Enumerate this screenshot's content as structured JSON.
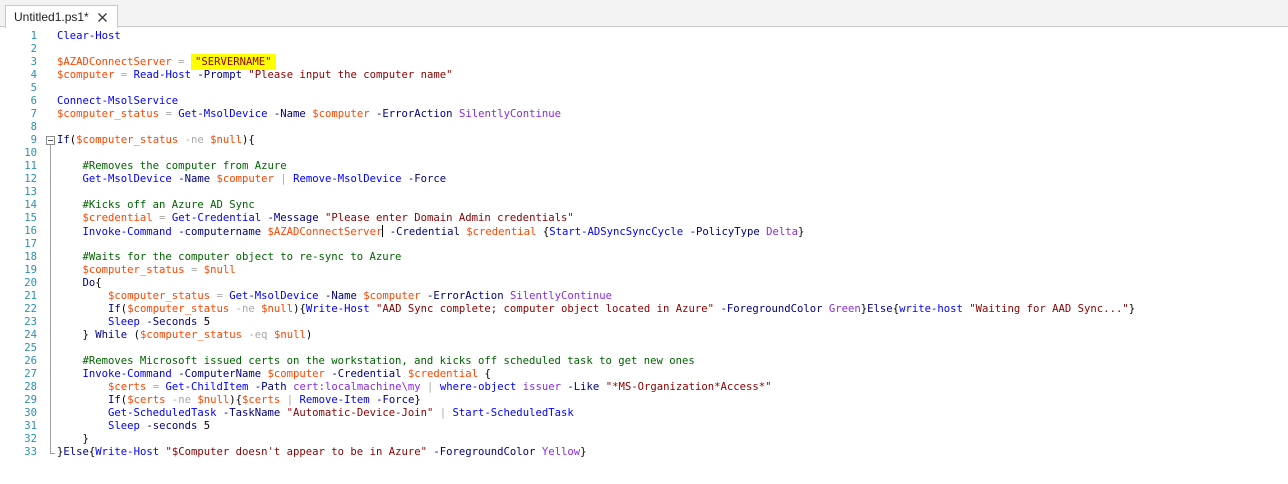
{
  "tab": {
    "title": "Untitled1.ps1*",
    "close_icon": "close-icon"
  },
  "colors": {
    "line_number": "#2b91af",
    "command": "#0000ff",
    "variable": "#ff4500",
    "string": "#8b0000",
    "parameter": "#000080",
    "operator": "#a9a9a9",
    "keyword": "#00008b",
    "comment": "#006400",
    "argument": "#8a2be2",
    "highlight": "#ffff00"
  },
  "lines": [
    {
      "n": "1",
      "indent": 0,
      "tokens": [
        [
          "cmd",
          "Clear-Host"
        ]
      ]
    },
    {
      "n": "2",
      "indent": 0,
      "tokens": []
    },
    {
      "n": "3",
      "indent": 0,
      "tokens": [
        [
          "var",
          "$AZADConnectServer"
        ],
        [
          "tx",
          " "
        ],
        [
          "op",
          "="
        ],
        [
          "tx",
          " "
        ],
        [
          "str-hl",
          "\"SERVERNAME\""
        ]
      ]
    },
    {
      "n": "4",
      "indent": 0,
      "tokens": [
        [
          "var",
          "$computer"
        ],
        [
          "tx",
          " "
        ],
        [
          "op",
          "="
        ],
        [
          "tx",
          " "
        ],
        [
          "cmd",
          "Read-Host"
        ],
        [
          "tx",
          " "
        ],
        [
          "par",
          "-Prompt"
        ],
        [
          "tx",
          " "
        ],
        [
          "str",
          "\"Please input the computer name\""
        ]
      ]
    },
    {
      "n": "5",
      "indent": 0,
      "tokens": []
    },
    {
      "n": "6",
      "indent": 0,
      "tokens": [
        [
          "cmd",
          "Connect-MsolService"
        ]
      ]
    },
    {
      "n": "7",
      "indent": 0,
      "tokens": [
        [
          "var",
          "$computer_status"
        ],
        [
          "tx",
          " "
        ],
        [
          "op",
          "="
        ],
        [
          "tx",
          " "
        ],
        [
          "cmd",
          "Get-MsolDevice"
        ],
        [
          "tx",
          " "
        ],
        [
          "par",
          "-Name"
        ],
        [
          "tx",
          " "
        ],
        [
          "var",
          "$computer"
        ],
        [
          "tx",
          " "
        ],
        [
          "par",
          "-ErrorAction"
        ],
        [
          "tx",
          " "
        ],
        [
          "arg",
          "SilentlyContinue"
        ]
      ]
    },
    {
      "n": "8",
      "indent": 0,
      "tokens": []
    },
    {
      "n": "9",
      "indent": 0,
      "fold": "start",
      "tokens": [
        [
          "kw",
          "If"
        ],
        [
          "grp",
          "("
        ],
        [
          "var",
          "$computer_status"
        ],
        [
          "tx",
          " "
        ],
        [
          "op",
          "-ne"
        ],
        [
          "tx",
          " "
        ],
        [
          "var",
          "$null"
        ],
        [
          "grp",
          "){"
        ]
      ]
    },
    {
      "n": "10",
      "indent": 0,
      "tokens": []
    },
    {
      "n": "11",
      "indent": 4,
      "tokens": [
        [
          "cmt",
          "#Removes the computer from Azure"
        ]
      ]
    },
    {
      "n": "12",
      "indent": 4,
      "tokens": [
        [
          "cmd",
          "Get-MsolDevice"
        ],
        [
          "tx",
          " "
        ],
        [
          "par",
          "-Name"
        ],
        [
          "tx",
          " "
        ],
        [
          "var",
          "$computer"
        ],
        [
          "tx",
          " "
        ],
        [
          "op",
          "|"
        ],
        [
          "tx",
          " "
        ],
        [
          "cmd",
          "Remove-MsolDevice"
        ],
        [
          "tx",
          " "
        ],
        [
          "par",
          "-Force"
        ]
      ]
    },
    {
      "n": "13",
      "indent": 0,
      "tokens": []
    },
    {
      "n": "14",
      "indent": 4,
      "tokens": [
        [
          "cmt",
          "#Kicks off an Azure AD Sync"
        ]
      ]
    },
    {
      "n": "15",
      "indent": 4,
      "tokens": [
        [
          "var",
          "$credential"
        ],
        [
          "tx",
          " "
        ],
        [
          "op",
          "="
        ],
        [
          "tx",
          " "
        ],
        [
          "cmd",
          "Get-Credential"
        ],
        [
          "tx",
          " "
        ],
        [
          "par",
          "-Message"
        ],
        [
          "tx",
          " "
        ],
        [
          "str",
          "\"Please enter Domain Admin credentials\""
        ]
      ]
    },
    {
      "n": "16",
      "indent": 4,
      "tokens": [
        [
          "cmd",
          "Invoke-Command"
        ],
        [
          "tx",
          " "
        ],
        [
          "par",
          "-computername"
        ],
        [
          "tx",
          " "
        ],
        [
          "var",
          "$AZADConnectServer"
        ],
        [
          "caret",
          ""
        ],
        [
          "tx",
          " "
        ],
        [
          "par",
          "-Credential"
        ],
        [
          "tx",
          " "
        ],
        [
          "var",
          "$credential"
        ],
        [
          "tx",
          " "
        ],
        [
          "grp",
          "{"
        ],
        [
          "cmd",
          "Start-ADSyncSyncCycle"
        ],
        [
          "tx",
          " "
        ],
        [
          "par",
          "-PolicyType"
        ],
        [
          "tx",
          " "
        ],
        [
          "arg",
          "Delta"
        ],
        [
          "grp",
          "}"
        ]
      ]
    },
    {
      "n": "17",
      "indent": 0,
      "tokens": []
    },
    {
      "n": "18",
      "indent": 4,
      "tokens": [
        [
          "cmt",
          "#Waits for the computer object to re-sync to Azure"
        ]
      ]
    },
    {
      "n": "19",
      "indent": 4,
      "tokens": [
        [
          "var",
          "$computer_status"
        ],
        [
          "tx",
          " "
        ],
        [
          "op",
          "="
        ],
        [
          "tx",
          " "
        ],
        [
          "var",
          "$null"
        ]
      ]
    },
    {
      "n": "20",
      "indent": 4,
      "tokens": [
        [
          "kw",
          "Do"
        ],
        [
          "grp",
          "{"
        ]
      ]
    },
    {
      "n": "21",
      "indent": 8,
      "tokens": [
        [
          "var",
          "$computer_status"
        ],
        [
          "tx",
          " "
        ],
        [
          "op",
          "="
        ],
        [
          "tx",
          " "
        ],
        [
          "cmd",
          "Get-MsolDevice"
        ],
        [
          "tx",
          " "
        ],
        [
          "par",
          "-Name"
        ],
        [
          "tx",
          " "
        ],
        [
          "var",
          "$computer"
        ],
        [
          "tx",
          " "
        ],
        [
          "par",
          "-ErrorAction"
        ],
        [
          "tx",
          " "
        ],
        [
          "arg",
          "SilentlyContinue"
        ]
      ]
    },
    {
      "n": "22",
      "indent": 8,
      "tokens": [
        [
          "kw",
          "If"
        ],
        [
          "grp",
          "("
        ],
        [
          "var",
          "$computer_status"
        ],
        [
          "tx",
          " "
        ],
        [
          "op",
          "-ne"
        ],
        [
          "tx",
          " "
        ],
        [
          "var",
          "$null"
        ],
        [
          "grp",
          "){"
        ],
        [
          "cmd",
          "Write-Host"
        ],
        [
          "tx",
          " "
        ],
        [
          "str",
          "\"AAD Sync complete; computer object located in Azure\""
        ],
        [
          "tx",
          " "
        ],
        [
          "par",
          "-ForegroundColor"
        ],
        [
          "tx",
          " "
        ],
        [
          "arg",
          "Green"
        ],
        [
          "grp",
          "}"
        ],
        [
          "kw",
          "Else"
        ],
        [
          "grp",
          "{"
        ],
        [
          "cmd",
          "write-host"
        ],
        [
          "tx",
          " "
        ],
        [
          "str",
          "\"Waiting for AAD Sync...\""
        ],
        [
          "grp",
          "}"
        ]
      ]
    },
    {
      "n": "23",
      "indent": 8,
      "tokens": [
        [
          "cmd",
          "Sleep"
        ],
        [
          "tx",
          " "
        ],
        [
          "par",
          "-Seconds"
        ],
        [
          "tx",
          " "
        ],
        [
          "tx",
          "5"
        ]
      ]
    },
    {
      "n": "24",
      "indent": 4,
      "tokens": [
        [
          "grp",
          "}"
        ],
        [
          "tx",
          " "
        ],
        [
          "kw",
          "While"
        ],
        [
          "tx",
          " "
        ],
        [
          "grp",
          "("
        ],
        [
          "var",
          "$computer_status"
        ],
        [
          "tx",
          " "
        ],
        [
          "op",
          "-eq"
        ],
        [
          "tx",
          " "
        ],
        [
          "var",
          "$null"
        ],
        [
          "grp",
          ")"
        ]
      ]
    },
    {
      "n": "25",
      "indent": 0,
      "tokens": []
    },
    {
      "n": "26",
      "indent": 4,
      "tokens": [
        [
          "cmt",
          "#Removes Microsoft issued certs on the workstation, and kicks off scheduled task to get new ones"
        ]
      ]
    },
    {
      "n": "27",
      "indent": 4,
      "tokens": [
        [
          "cmd",
          "Invoke-Command"
        ],
        [
          "tx",
          " "
        ],
        [
          "par",
          "-ComputerName"
        ],
        [
          "tx",
          " "
        ],
        [
          "var",
          "$computer"
        ],
        [
          "tx",
          " "
        ],
        [
          "par",
          "-Credential"
        ],
        [
          "tx",
          " "
        ],
        [
          "var",
          "$credential"
        ],
        [
          "tx",
          " "
        ],
        [
          "grp",
          "{"
        ]
      ]
    },
    {
      "n": "28",
      "indent": 8,
      "tokens": [
        [
          "var",
          "$certs"
        ],
        [
          "tx",
          " "
        ],
        [
          "op",
          "="
        ],
        [
          "tx",
          " "
        ],
        [
          "cmd",
          "Get-ChildItem"
        ],
        [
          "tx",
          " "
        ],
        [
          "par",
          "-Path"
        ],
        [
          "tx",
          " "
        ],
        [
          "arg",
          "cert:localmachine\\my"
        ],
        [
          "tx",
          " "
        ],
        [
          "op",
          "|"
        ],
        [
          "tx",
          " "
        ],
        [
          "cmd",
          "where-object"
        ],
        [
          "tx",
          " "
        ],
        [
          "arg",
          "issuer"
        ],
        [
          "tx",
          " "
        ],
        [
          "par",
          "-Like"
        ],
        [
          "tx",
          " "
        ],
        [
          "str",
          "\"*MS-Organization*Access*\""
        ]
      ]
    },
    {
      "n": "29",
      "indent": 8,
      "tokens": [
        [
          "kw",
          "If"
        ],
        [
          "grp",
          "("
        ],
        [
          "var",
          "$certs"
        ],
        [
          "tx",
          " "
        ],
        [
          "op",
          "-ne"
        ],
        [
          "tx",
          " "
        ],
        [
          "var",
          "$null"
        ],
        [
          "grp",
          "){"
        ],
        [
          "var",
          "$certs"
        ],
        [
          "tx",
          " "
        ],
        [
          "op",
          "|"
        ],
        [
          "tx",
          " "
        ],
        [
          "cmd",
          "Remove-Item"
        ],
        [
          "tx",
          " "
        ],
        [
          "par",
          "-Force"
        ],
        [
          "grp",
          "}"
        ]
      ]
    },
    {
      "n": "30",
      "indent": 8,
      "tokens": [
        [
          "cmd",
          "Get-ScheduledTask"
        ],
        [
          "tx",
          " "
        ],
        [
          "par",
          "-TaskName"
        ],
        [
          "tx",
          " "
        ],
        [
          "str",
          "\"Automatic-Device-Join\""
        ],
        [
          "tx",
          " "
        ],
        [
          "op",
          "|"
        ],
        [
          "tx",
          " "
        ],
        [
          "cmd",
          "Start-ScheduledTask"
        ]
      ]
    },
    {
      "n": "31",
      "indent": 8,
      "tokens": [
        [
          "cmd",
          "Sleep"
        ],
        [
          "tx",
          " "
        ],
        [
          "par",
          "-seconds"
        ],
        [
          "tx",
          " "
        ],
        [
          "tx",
          "5"
        ]
      ]
    },
    {
      "n": "32",
      "indent": 4,
      "tokens": [
        [
          "grp",
          "}"
        ]
      ]
    },
    {
      "n": "33",
      "indent": 0,
      "fold": "end",
      "tokens": [
        [
          "grp",
          "}"
        ],
        [
          "kw",
          "Else"
        ],
        [
          "grp",
          "{"
        ],
        [
          "cmd",
          "Write-Host"
        ],
        [
          "tx",
          " "
        ],
        [
          "str",
          "\"$Computer doesn't appear to be in Azure\""
        ],
        [
          "tx",
          " "
        ],
        [
          "par",
          "-ForegroundColor"
        ],
        [
          "tx",
          " "
        ],
        [
          "arg",
          "Yellow"
        ],
        [
          "grp",
          "}"
        ]
      ]
    }
  ]
}
